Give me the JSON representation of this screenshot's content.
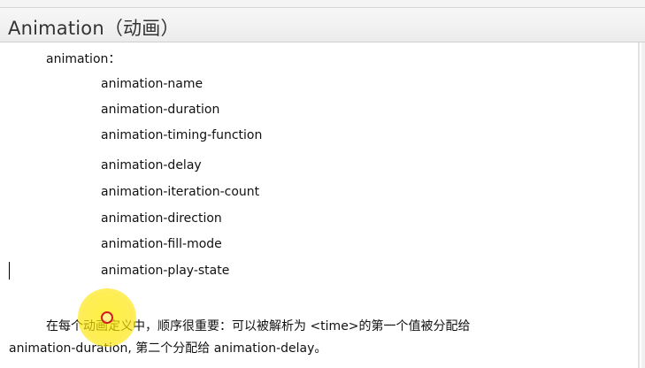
{
  "slide": {
    "title": "Animation（动画）",
    "heading": "animation：",
    "properties": [
      "animation-name",
      "animation-duration",
      "animation-timing-function",
      "animation-delay",
      "animation-iteration-count",
      "animation-direction",
      "animation-fill-mode",
      "animation-play-state"
    ],
    "paragraph_line1": "在每个动画定义中，顺序很重要：可以被解析为 <time>的第一个值被分配给",
    "paragraph_line2": "animation-duration, 第二个分配给 animation-delay。"
  }
}
